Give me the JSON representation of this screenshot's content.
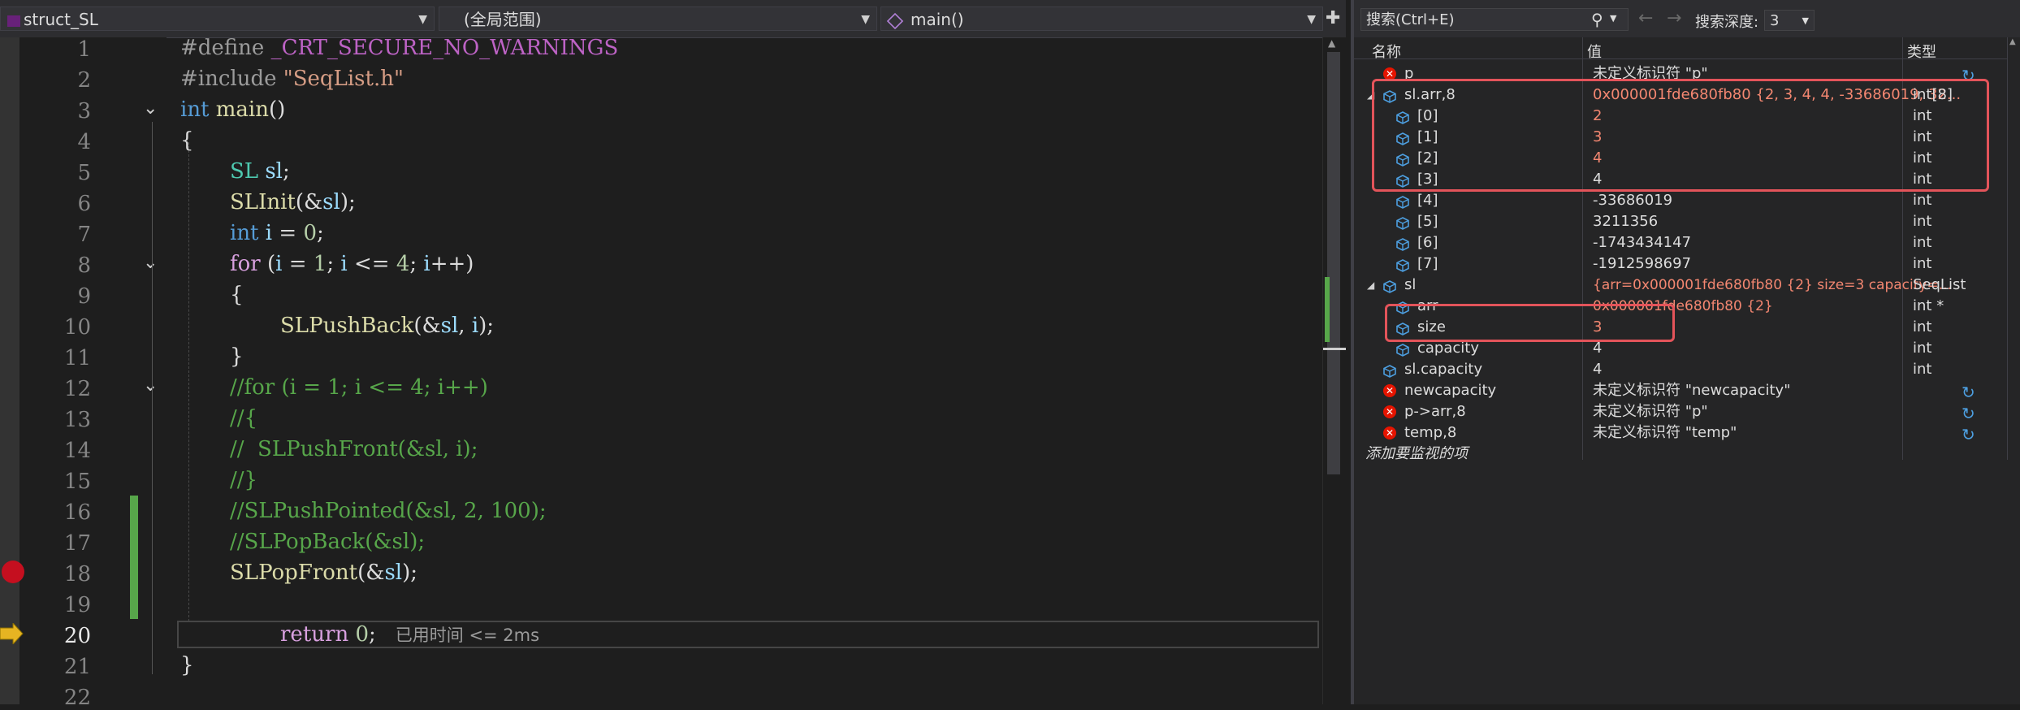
{
  "editor": {
    "nav": {
      "project_icon": "project-icon",
      "project": "struct_SL",
      "scope": "(全局范围)",
      "function_icon": "function-cube-icon",
      "function": "main()"
    },
    "lines": [
      "1",
      "2",
      "3",
      "4",
      "5",
      "6",
      "7",
      "8",
      "9",
      "10",
      "11",
      "12",
      "13",
      "14",
      "15",
      "16",
      "17",
      "18",
      "19",
      "20",
      "21",
      "22"
    ],
    "code": {
      "l1a": "#define ",
      "l1b": "_CRT_SECURE_NO_WARNINGS",
      "l2a": "#include ",
      "l2b": "\"SeqList.h\"",
      "l3a": "int ",
      "l3b": "main",
      "l3c": "()",
      "l4": "{",
      "l5a": "SL ",
      "l5b": "sl",
      "l5c": ";",
      "l6a": "SLInit",
      "l6b": "(&",
      "l6c": "sl",
      "l6d": ");",
      "l7a": "int ",
      "l7b": "i",
      "l7c": " = ",
      "l7d": "0",
      "l7e": ";",
      "l8a": "for ",
      "l8b": "(",
      "l8c": "i",
      "l8d": " = ",
      "l8e": "1",
      "l8f": "; ",
      "l8g": "i",
      "l8h": " <= ",
      "l8i": "4",
      "l8j": "; ",
      "l8k": "i",
      "l8l": "++)",
      "l9": "{",
      "l10a": "SLPushBack",
      "l10b": "(&",
      "l10c": "sl",
      "l10d": ", ",
      "l10e": "i",
      "l10f": ");",
      "l11": "}",
      "l12": "//for (i = 1; i <= 4; i++)",
      "l13": "//{",
      "l14": "//  SLPushFront(&sl, i);",
      "l15": "//}",
      "l16": "//SLPushPointed(&sl, 2, 100);",
      "l17": "//SLPopBack(&sl);",
      "l18a": "SLPopFront",
      "l18b": "(&",
      "l18c": "sl",
      "l18d": ");",
      "l20a": "return ",
      "l20b": "0",
      "l20c": ";",
      "l20hint": "已用时间 <= 2ms",
      "l21": "}"
    },
    "breakpoint_line": "18",
    "current_line": "20"
  },
  "watch": {
    "search_placeholder": "搜索(Ctrl+E)",
    "depth_label": "搜索深度:",
    "depth_value": "3",
    "headers": {
      "name": "名称",
      "value": "值",
      "type": "类型"
    },
    "rows": [
      {
        "name": "p",
        "value": "未定义标识符 \"p\"",
        "type": "",
        "icon": "error-icon"
      },
      {
        "name": "sl.arr,8",
        "value": "0x000001fde680fb80 {2, 3, 4, 4, -33686019, 32...",
        "type": "int[8]",
        "icon": "field-cube-icon"
      },
      {
        "name": "[0]",
        "value": "2",
        "type": "int",
        "icon": "field-cube-icon"
      },
      {
        "name": "[1]",
        "value": "3",
        "type": "int",
        "icon": "field-cube-icon"
      },
      {
        "name": "[2]",
        "value": "4",
        "type": "int",
        "icon": "field-cube-icon"
      },
      {
        "name": "[3]",
        "value": "4",
        "type": "int",
        "icon": "field-cube-icon"
      },
      {
        "name": "[4]",
        "value": "-33686019",
        "type": "int",
        "icon": "field-cube-icon"
      },
      {
        "name": "[5]",
        "value": "3211356",
        "type": "int",
        "icon": "field-cube-icon"
      },
      {
        "name": "[6]",
        "value": "-1743434147",
        "type": "int",
        "icon": "field-cube-icon"
      },
      {
        "name": "[7]",
        "value": "-1912598697",
        "type": "int",
        "icon": "field-cube-icon"
      },
      {
        "name": "sl",
        "value": "{arr=0x000001fde680fb80 {2} size=3 capacity=...",
        "type": "SeqList",
        "icon": "field-cube-icon"
      },
      {
        "name": "arr",
        "value": "0x000001fde680fb80 {2}",
        "type": "int *",
        "icon": "field-cube-icon"
      },
      {
        "name": "size",
        "value": "3",
        "type": "int",
        "icon": "field-cube-icon"
      },
      {
        "name": "capacity",
        "value": "4",
        "type": "int",
        "icon": "field-cube-icon"
      },
      {
        "name": "sl.capacity",
        "value": "4",
        "type": "int",
        "icon": "field-cube-icon"
      },
      {
        "name": "newcapacity",
        "value": "未定义标识符 \"newcapacity\"",
        "type": "",
        "icon": "error-icon"
      },
      {
        "name": "p->arr,8",
        "value": "未定义标识符 \"p\"",
        "type": "",
        "icon": "error-icon"
      },
      {
        "name": "temp,8",
        "value": "未定义标识符 \"temp\"",
        "type": "",
        "icon": "error-icon"
      }
    ],
    "add_item": "添加要监视的项"
  }
}
